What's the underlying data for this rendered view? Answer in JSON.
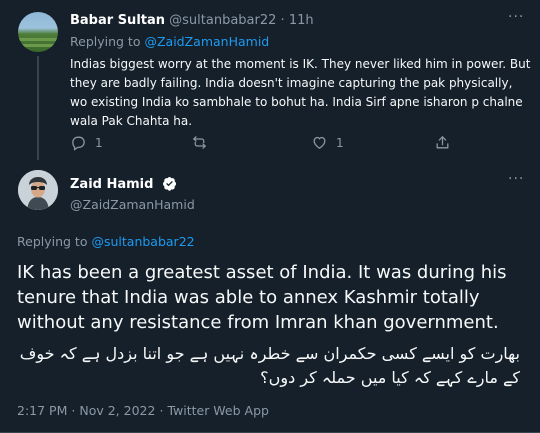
{
  "reply_tweet": {
    "author_name": "Babar Sultan",
    "author_handle": "@sultanbabar22",
    "separator": "·",
    "time_ago": "11h",
    "replying_to_label": "Replying to",
    "replying_to_handle": "@ZaidZamanHamid",
    "text": "Indias biggest worry at the moment is IK. They never liked him in power. But they are badly failing. India doesn't imagine capturing the pak physically, wo existing India ko sambhale to bohut ha. India Sirf apne isharon p chalne wala Pak Chahta ha.",
    "reply_count": "1",
    "like_count": "1",
    "more_label": "···"
  },
  "main_tweet": {
    "author_name": "Zaid Hamid",
    "author_handle": "@ZaidZamanHamid",
    "more_label": "···",
    "replying_to_label": "Replying to",
    "replying_to_handle": "@sultanbabar22",
    "text": "IK has been a greatest asset of India. It was during his tenure that India was able to annex Kashmir totally without any resistance from Imran khan government.",
    "urdu_text": "بھارت کو ایسے کسی حکمران سے خطرہ نہیں ہے جو اتنا بزدل ہے کہ خوف کے مارے کہے کہ کیا میں حملہ کر دوں؟",
    "time": "2:17 PM",
    "separator": "·",
    "date": "Nov 2, 2022",
    "source": "Twitter Web App"
  },
  "colors": {
    "background": "#15202b",
    "link": "#1d9bf0",
    "muted": "#8b98a5",
    "verified": "#ffffff"
  },
  "icons": [
    "reply-icon",
    "retweet-icon",
    "like-icon",
    "share-icon",
    "verified-badge-icon",
    "more-icon"
  ]
}
